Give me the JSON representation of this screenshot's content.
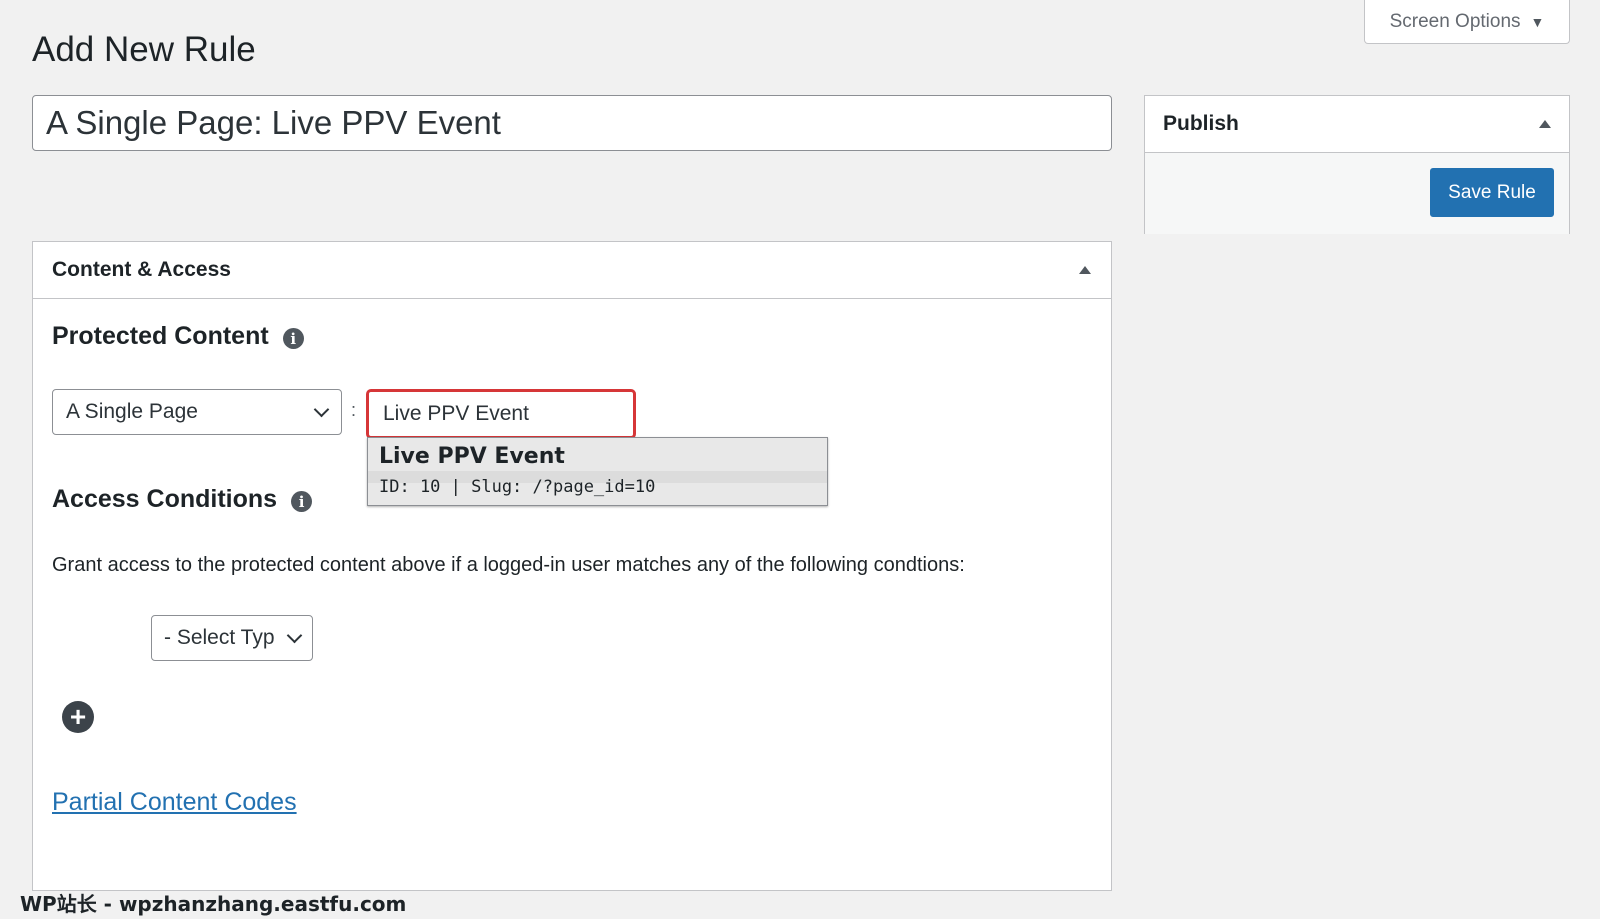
{
  "header": {
    "screen_options_label": "Screen Options",
    "page_title": "Add New Rule"
  },
  "title_input": {
    "value": "A Single Page: Live PPV Event"
  },
  "publish": {
    "heading": "Publish",
    "save_label": "Save Rule"
  },
  "content_access": {
    "heading": "Content & Access",
    "protected_content": {
      "title": "Protected Content",
      "content_type": "A Single Page",
      "separator": ":",
      "search_value": "Live PPV Event",
      "suggestion": {
        "title": "Live PPV Event",
        "meta": "ID: 10 | Slug: /?page_id=10"
      }
    },
    "access_conditions": {
      "title": "Access Conditions",
      "description": "Grant access to the protected content above if a logged-in user matches any of the following condtions:",
      "select_type": "- Select Typ"
    },
    "partial_link": "Partial Content Codes"
  },
  "watermark": "WP站长 - wpzhanzhang.eastfu.com",
  "colors": {
    "primary": "#2271b1",
    "error": "#d63638"
  }
}
